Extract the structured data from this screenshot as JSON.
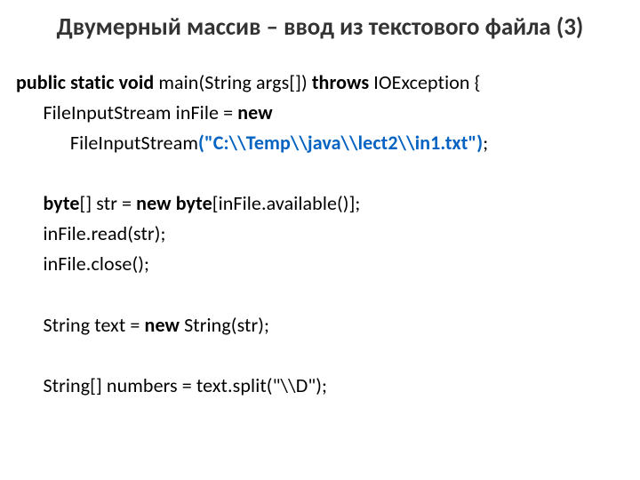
{
  "title": "Двумерный массив – ввод из текстового файла (3)",
  "code": {
    "l1a": "public static void",
    "l1b": " main(String args[]) ",
    "l1c": "throws",
    "l1d": " IOException {",
    "l2a": "      FileInputStream inFile = ",
    "l2b": "new",
    "l3a": "            FileInputStream",
    "l3b": "(\"C:\\\\Temp\\\\java\\\\lect2\\\\in1.txt\")",
    "l3c": ";",
    "blank": " ",
    "l4a": "      byte",
    "l4b": "[] str = ",
    "l4c": "new byte",
    "l4d": "[inFile.available()];",
    "l5": "      inFile.read(str);",
    "l6": "      inFile.close();",
    "l7a": "      String text = ",
    "l7b": "new",
    "l7c": " String(str);",
    "l8": "      String[] numbers = text.split(\"\\\\D\");"
  }
}
